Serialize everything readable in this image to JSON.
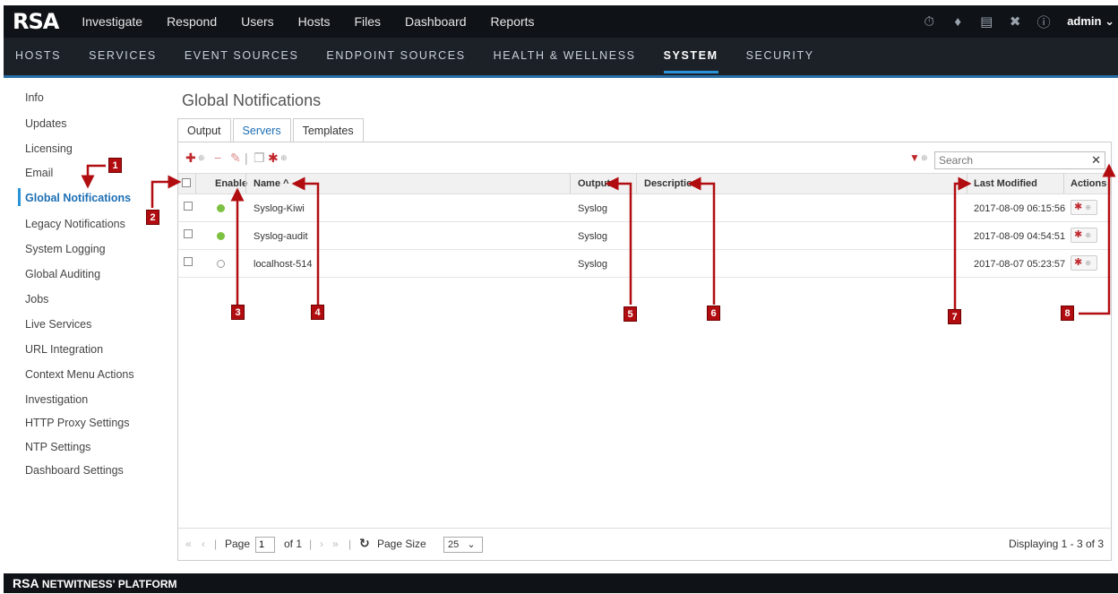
{
  "app": {
    "logo": "RSA",
    "main_nav": [
      "Investigate",
      "Respond",
      "Users",
      "Hosts",
      "Files",
      "Dashboard",
      "Reports"
    ],
    "user": "admin"
  },
  "sub_nav": {
    "items": [
      "HOSTS",
      "SERVICES",
      "EVENT SOURCES",
      "ENDPOINT SOURCES",
      "HEALTH & WELLNESS",
      "SYSTEM",
      "SECURITY"
    ],
    "active": "SYSTEM"
  },
  "sidebar": {
    "items": [
      "Info",
      "Updates",
      "Licensing",
      "Email",
      "Global Notifications",
      "Legacy Notifications",
      "System Logging",
      "Global Auditing",
      "Jobs",
      "Live Services",
      "URL Integration",
      "Context Menu Actions",
      "Investigation",
      "HTTP Proxy Settings",
      "NTP Settings",
      "Dashboard Settings"
    ],
    "active": "Global Notifications"
  },
  "page": {
    "title": "Global Notifications",
    "tabs": [
      "Output",
      "Servers",
      "Templates"
    ],
    "active_tab": "Servers"
  },
  "search": {
    "placeholder": "Search"
  },
  "table": {
    "headers": {
      "enable": "Enable",
      "name": "Name ^",
      "output": "Output",
      "description": "Description",
      "last_modified": "Last Modified",
      "actions": "Actions"
    },
    "rows": [
      {
        "enabled": true,
        "name": "Syslog-Kiwi",
        "output": "Syslog",
        "description": "",
        "last_modified": "2017-08-09 06:15:56"
      },
      {
        "enabled": true,
        "name": "Syslog-audit",
        "output": "Syslog",
        "description": "",
        "last_modified": "2017-08-09 04:54:51"
      },
      {
        "enabled": false,
        "name": "localhost-514",
        "output": "Syslog",
        "description": "",
        "last_modified": "2017-08-07 05:23:57"
      }
    ]
  },
  "pager": {
    "page_label": "Page",
    "page_value": "1",
    "of_label": "of 1",
    "page_size_label": "Page Size",
    "page_size": "25",
    "displaying": "Displaying 1 - 3 of 3"
  },
  "footer": {
    "brand_mark": "RSA",
    "brand_text": "NETWITNESS' PLATFORM"
  },
  "callouts": [
    "1",
    "2",
    "3",
    "4",
    "5",
    "6",
    "7",
    "8"
  ],
  "colors": {
    "accent": "#2a93d8",
    "callout": "#b10d11",
    "enabled_dot": "#7dc142",
    "topbar": "#0f1217"
  }
}
